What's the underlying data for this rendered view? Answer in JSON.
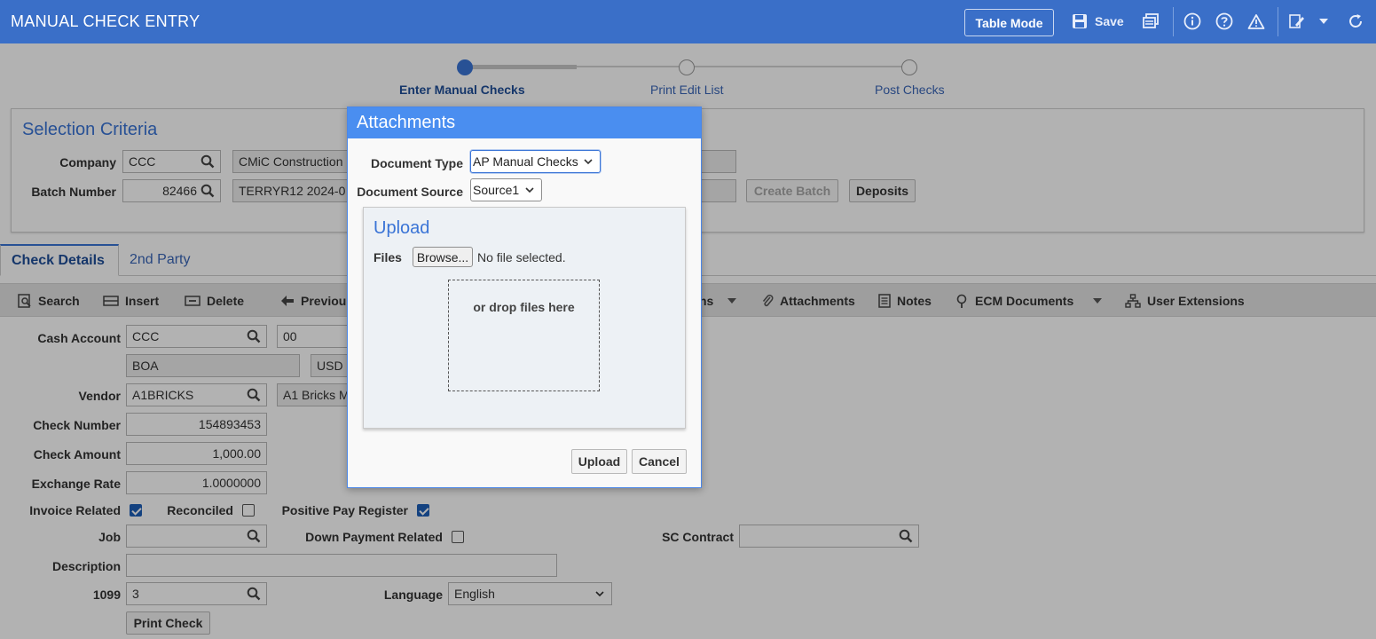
{
  "header": {
    "title": "MANUAL CHECK ENTRY",
    "table_mode_label": "Table Mode",
    "save_label": "Save"
  },
  "stepper": {
    "steps": [
      {
        "label": "Enter Manual Checks",
        "active": true
      },
      {
        "label": "Print Edit List",
        "active": false
      },
      {
        "label": "Post Checks",
        "active": false
      }
    ]
  },
  "selection_criteria": {
    "title": "Selection Criteria",
    "company_label": "Company",
    "company_value": "CCC",
    "company_name": "CMiC Construction",
    "batch_label": "Batch Number",
    "batch_value": "82466",
    "batch_desc": "TERRYR12 2024-0",
    "create_batch_label": "Create Batch",
    "deposits_label": "Deposits"
  },
  "tabs": [
    {
      "label": "Check Details",
      "active": true
    },
    {
      "label": "2nd Party",
      "active": false
    }
  ],
  "toolbar": {
    "search": "Search",
    "insert": "Insert",
    "delete": "Delete",
    "previous": "Previou",
    "hidden_item_tail": "ns",
    "attachments": "Attachments",
    "notes": "Notes",
    "ecm_documents": "ECM Documents",
    "user_extensions": "User Extensions"
  },
  "form": {
    "cash_account_label": "Cash Account",
    "cash_account_value": "CCC",
    "cash_account_code": "00",
    "bank_value": "BOA",
    "currency_value": "USD C",
    "vendor_label": "Vendor",
    "vendor_value": "A1BRICKS",
    "vendor_name": "A1 Bricks M",
    "check_number_label": "Check Number",
    "check_number_value": "154893453",
    "check_amount_label": "Check Amount",
    "check_amount_value": "1,000.00",
    "exchange_rate_label": "Exchange Rate",
    "exchange_rate_value": "1.0000000",
    "invoice_related_label": "Invoice Related",
    "invoice_related_checked": true,
    "reconciled_label": "Reconciled",
    "reconciled_checked": false,
    "positive_pay_label": "Positive Pay Register",
    "positive_pay_checked": true,
    "job_label": "Job",
    "job_value": "",
    "down_payment_label": "Down Payment Related",
    "down_payment_checked": false,
    "sc_contract_label": "SC Contract",
    "sc_contract_value": "",
    "description_label": "Description",
    "description_value": "",
    "form_1099_label": "1099",
    "form_1099_value": "3",
    "language_label": "Language",
    "language_value": "English",
    "print_check_label": "Print Check"
  },
  "dialog": {
    "title": "Attachments",
    "document_type_label": "Document Type",
    "document_type_value": "AP Manual Checks",
    "document_source_label": "Document Source",
    "document_source_value": "Source1",
    "upload_title": "Upload",
    "files_label": "Files",
    "browse_label": "Browse...",
    "no_file_text": "No file selected.",
    "drop_text": "or drop files here",
    "upload_button": "Upload",
    "cancel_button": "Cancel"
  },
  "colors": {
    "header_blue": "#3a6fc8",
    "dialog_header_blue": "#4a8ef0",
    "accent_blue": "#3a74d6",
    "checkbox_blue": "#1e5fb8"
  }
}
